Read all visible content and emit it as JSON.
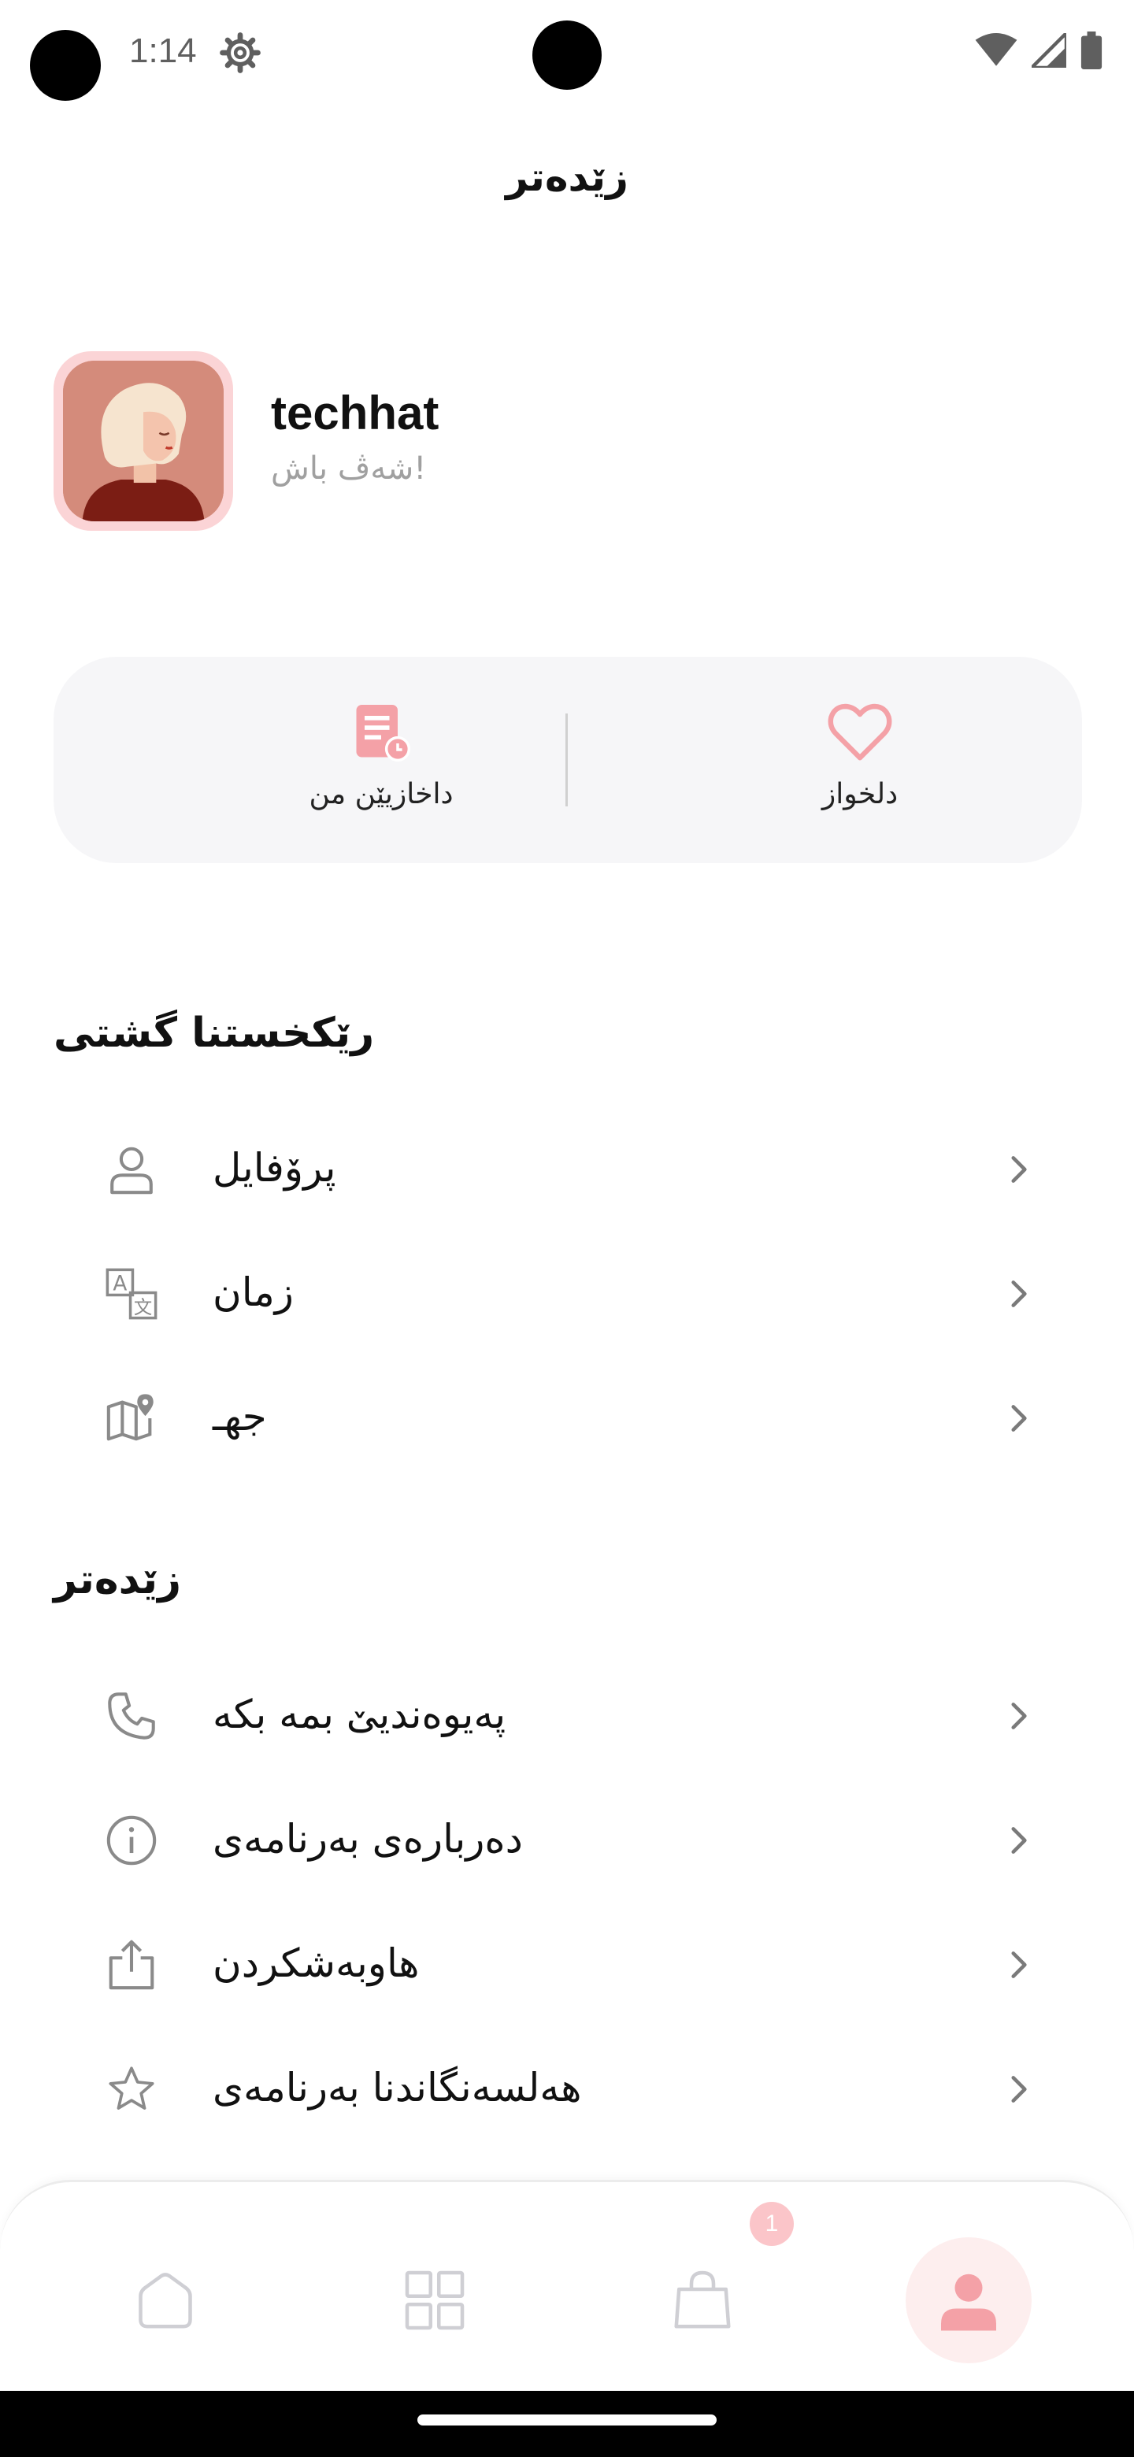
{
  "status_bar": {
    "time": "1:14"
  },
  "header": {
    "title": "زێدەتر"
  },
  "profile": {
    "name": "techhat",
    "greeting": "شەڤ باش!"
  },
  "quick_actions": {
    "requests_label": "داخازیێن من",
    "favorites_label": "دلخواز"
  },
  "general_section": {
    "title": "رێکخستنا گشتی",
    "items": [
      {
        "label": "پرۆفایل",
        "icon": "person-icon"
      },
      {
        "label": "زمان",
        "icon": "translate-icon"
      },
      {
        "label": "جهـ",
        "icon": "map-pin-icon"
      }
    ]
  },
  "more_section": {
    "title": "زێدەتر",
    "items": [
      {
        "label": "پەیوەندیێ بمە بکە",
        "icon": "phone-icon"
      },
      {
        "label": "دەربارەی بەرنامەی",
        "icon": "info-icon"
      },
      {
        "label": "هاوبەشکردن",
        "icon": "share-icon"
      },
      {
        "label": "هەلسەنگاندنا بەرنامەی",
        "icon": "star-icon"
      }
    ]
  },
  "bottom_nav": {
    "cart_badge": "1"
  },
  "colors": {
    "accent": "#f4a1a7",
    "accent_light": "#fdeeee",
    "card_bg": "#f6f6f8"
  }
}
